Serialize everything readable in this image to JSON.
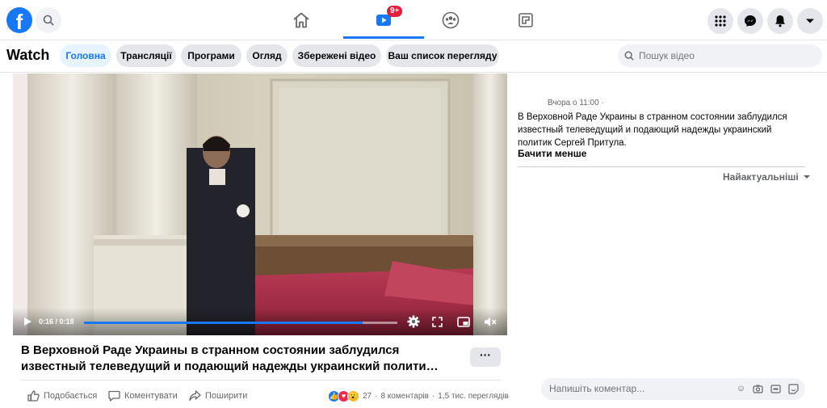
{
  "topbar": {
    "logo_letter": "f",
    "video_badge": "9+"
  },
  "watchbar": {
    "title": "Watch",
    "tabs": [
      {
        "label": "Головна",
        "active": true
      },
      {
        "label": "Трансляції",
        "active": false
      },
      {
        "label": "Програми",
        "active": false
      },
      {
        "label": "Огляд",
        "active": false
      },
      {
        "label": "Збережені відео",
        "active": false
      },
      {
        "label": "Ваш список перегляду",
        "active": false
      }
    ],
    "search_placeholder": "Пошук відео"
  },
  "video": {
    "time": "0:16 / 0:18",
    "progress": 0.89,
    "title": "В Верховной Раде Украины в странном состоянии заблудился известный телеведущий и подающий надежды украинский полити…",
    "more": "···"
  },
  "actions": {
    "like": "Подобається",
    "comment": "Коментувати",
    "share": "Поширити",
    "reactions_count": "27",
    "comments": "8 коментарів",
    "views": "1,5 тис. переглядів"
  },
  "side": {
    "meta": "Вчора о 11:00 ·",
    "description": "В Верховной Раде Украины в странном состоянии заблудился известный телеведущий и подающий надежды украинский политик Сергей Притула.",
    "see_less": "Бачити менше",
    "sort": "Найактуальніші",
    "comment_placeholder": "Напишіть коментар..."
  },
  "colors": {
    "brand": "#1877f2",
    "badge": "#e41e3f"
  }
}
